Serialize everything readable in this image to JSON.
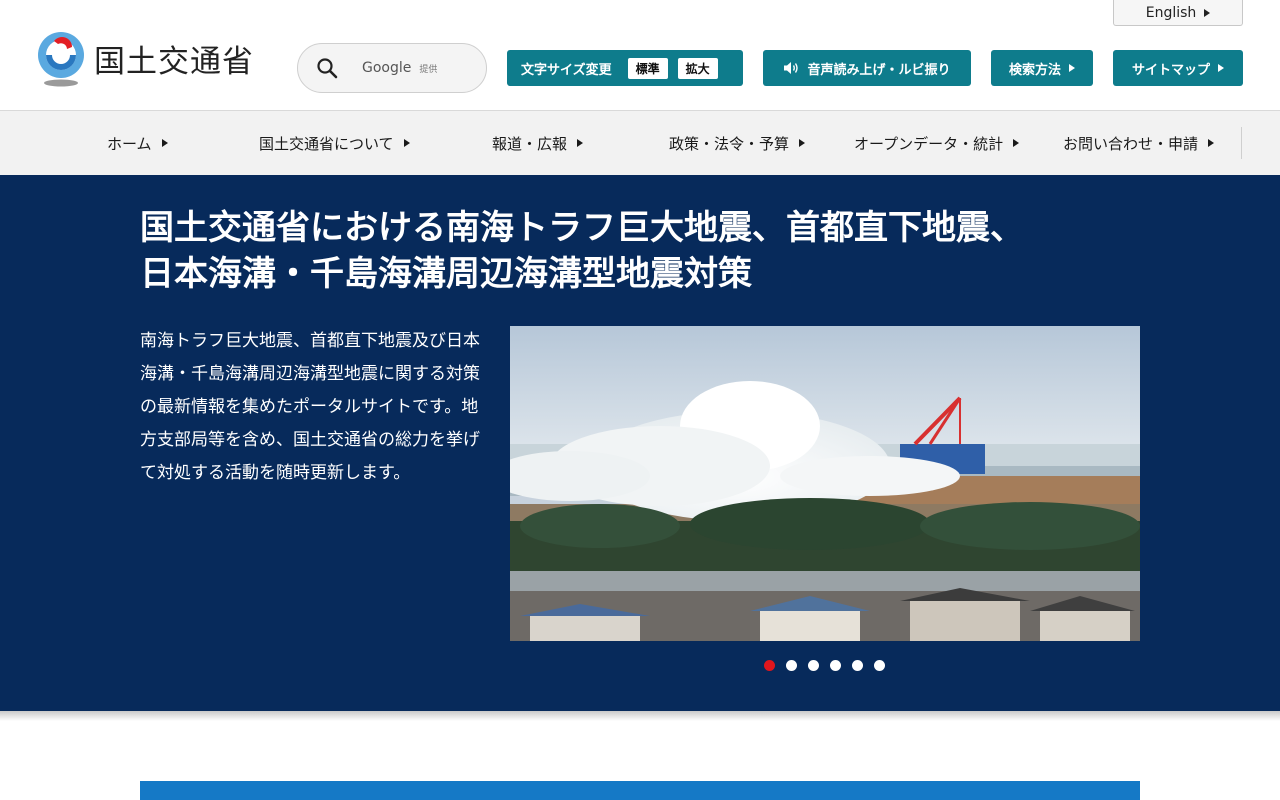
{
  "header": {
    "logo_text": "国土交通省",
    "english_label": "English",
    "search": {
      "label": "Google",
      "sub": "提供"
    },
    "font_size": {
      "label": "文字サイズ変更",
      "options": [
        "標準",
        "拡大"
      ]
    },
    "voice_label": "音声読み上げ・ルビ振り",
    "howto_label": "検索方法",
    "sitemap_label": "サイトマップ"
  },
  "nav": {
    "items": [
      {
        "label": "ホーム"
      },
      {
        "label": "国土交通省について"
      },
      {
        "label": "報道・広報"
      },
      {
        "label": "政策・法令・予算"
      },
      {
        "label": "オープンデータ・統計"
      },
      {
        "label": "お問い合わせ・申請"
      }
    ]
  },
  "hero": {
    "title_line1": "国土交通省における南海トラフ巨大地震、首都直下地震、",
    "title_line2": "日本海溝・千島海溝周辺海溝型地震対策",
    "description": "南海トラフ巨大地震、首都直下地震及び日本海溝・千島海溝周辺海溝型地震に関する対策の最新情報を集めたポータルサイトです。地方支部局等を含め、国土交通省の総力を挙げて対処する活動を随時更新します。",
    "slides": {
      "count": 6,
      "active": 1
    }
  },
  "colors": {
    "teal": "#0e7c8c",
    "navy": "#072a5b",
    "active_dot": "#e0161d",
    "band_blue": "#1579c6"
  }
}
